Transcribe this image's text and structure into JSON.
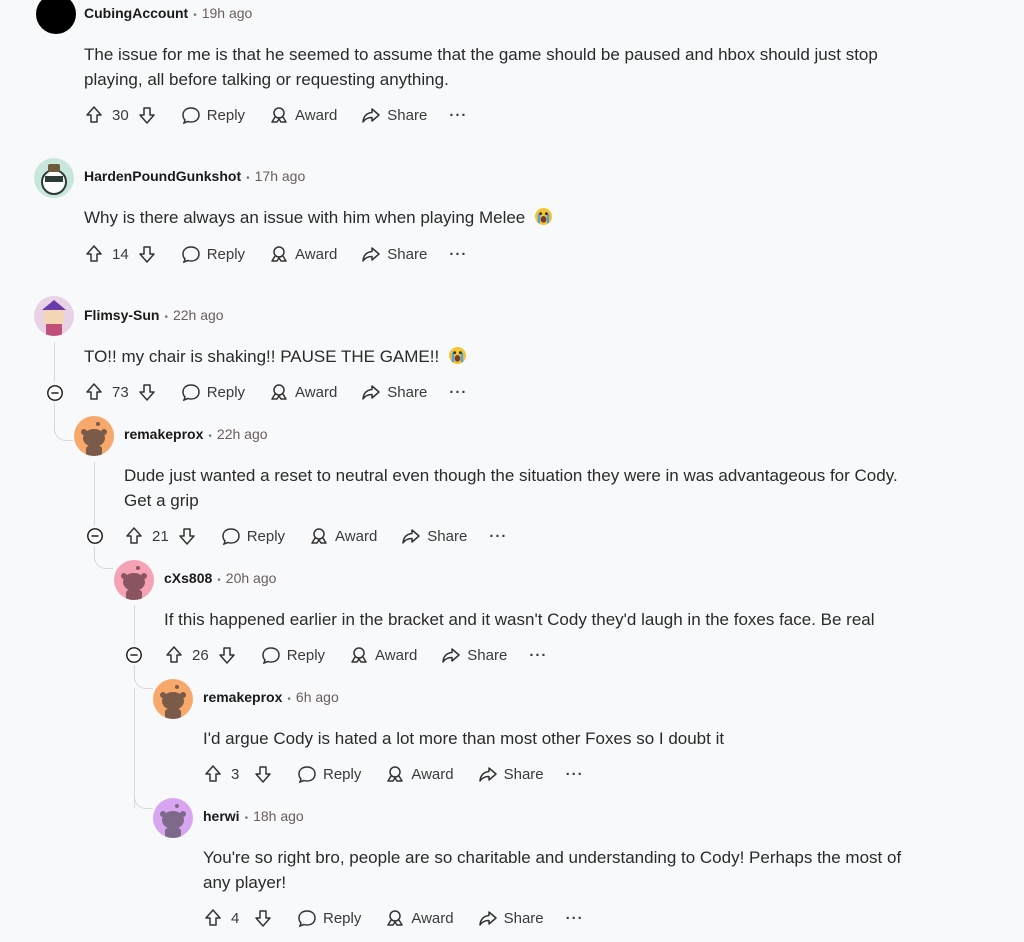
{
  "action_labels": {
    "reply": "Reply",
    "award": "Award",
    "share": "Share",
    "more": "···"
  },
  "comments": [
    {
      "user": "CubingAccount",
      "time": "19h ago",
      "lines": [
        "The issue for me is that he seemed to assume that the game should be paused and hbox should just stop",
        "playing, all before talking or requesting anything."
      ],
      "votes": "30",
      "avatar_color": "#000000"
    },
    {
      "user": "HardenPoundGunkshot",
      "time": "17h ago",
      "lines": [
        "Why is there always an issue with him when playing Melee"
      ],
      "votes": "14",
      "avatar_color": "#c9e6dc",
      "emoji": "crying-face"
    },
    {
      "user": "Flimsy-Sun",
      "time": "22h ago",
      "lines": [
        "TO!! my chair is shaking!! PAUSE THE GAME!!"
      ],
      "votes": "73",
      "avatar_color": "#e9d2e6",
      "emoji": "crying-face"
    },
    {
      "user": "remakeprox",
      "time": "22h ago",
      "lines": [
        "Dude just wanted a reset to neutral even though the situation they were in was advantageous for Cody.",
        "Get a grip"
      ],
      "votes": "21",
      "avatar_color": "#f7a96b"
    },
    {
      "user": "cXs808",
      "time": "20h ago",
      "lines": [
        "If this happened earlier in the bracket and it wasn't Cody they'd laugh in the foxes face. Be real"
      ],
      "votes": "26",
      "avatar_color": "#f5a3b4"
    },
    {
      "user": "remakeprox",
      "time": "6h ago",
      "lines": [
        "I'd argue Cody is hated a lot more than most other Foxes so I doubt it"
      ],
      "votes": "3",
      "avatar_color": "#f7a96b"
    },
    {
      "user": "herwi",
      "time": "18h ago",
      "lines": [
        "You're so right bro, people are so charitable and understanding to Cody! Perhaps the most of",
        "any player!"
      ],
      "votes": "4",
      "avatar_color": "#d8a6f0"
    }
  ]
}
